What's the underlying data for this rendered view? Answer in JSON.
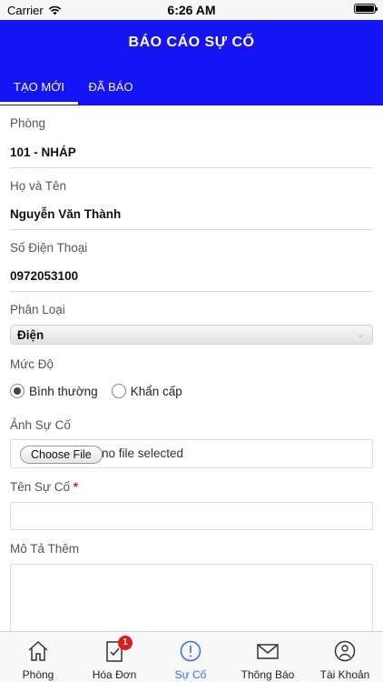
{
  "status_bar": {
    "carrier": "Carrier",
    "time": "6:26 AM"
  },
  "header": {
    "title": "BÁO CÁO SỰ CỐ"
  },
  "tabs": [
    {
      "label": "TẠO MỚI",
      "active": true
    },
    {
      "label": "ĐÃ BÁO",
      "active": false
    }
  ],
  "form": {
    "room": {
      "label": "Phòng",
      "value": "101 - NHÁP"
    },
    "name": {
      "label": "Họ và Tên",
      "value": "Nguyễn Văn Thành"
    },
    "phone": {
      "label": "Số Điện Thoại",
      "value": "0972053100"
    },
    "category": {
      "label": "Phân Loại",
      "selected": "Điện"
    },
    "severity": {
      "label": "Mức Độ",
      "options": [
        {
          "label": "Bình thường",
          "checked": true
        },
        {
          "label": "Khẩn cấp",
          "checked": false
        }
      ]
    },
    "photo": {
      "label": "Ảnh Sự Cố",
      "button": "Choose File",
      "status": "no file selected"
    },
    "title": {
      "label": "Tên Sự Cố",
      "required_mark": "*",
      "value": ""
    },
    "description": {
      "label": "Mô Tả Thêm",
      "value": ""
    }
  },
  "bottom_nav": [
    {
      "label": "Phòng",
      "icon": "home-icon"
    },
    {
      "label": "Hóa Đơn",
      "icon": "invoice-icon",
      "badge": "1"
    },
    {
      "label": "Sự Cố",
      "icon": "alert-circle-icon",
      "active": true
    },
    {
      "label": "Thông Báo",
      "icon": "mail-icon"
    },
    {
      "label": "Tài Khoản",
      "icon": "user-icon"
    }
  ],
  "colors": {
    "header_bg": "#1414f5",
    "active_nav": "#2b6ee8",
    "badge": "#e01b1b"
  }
}
